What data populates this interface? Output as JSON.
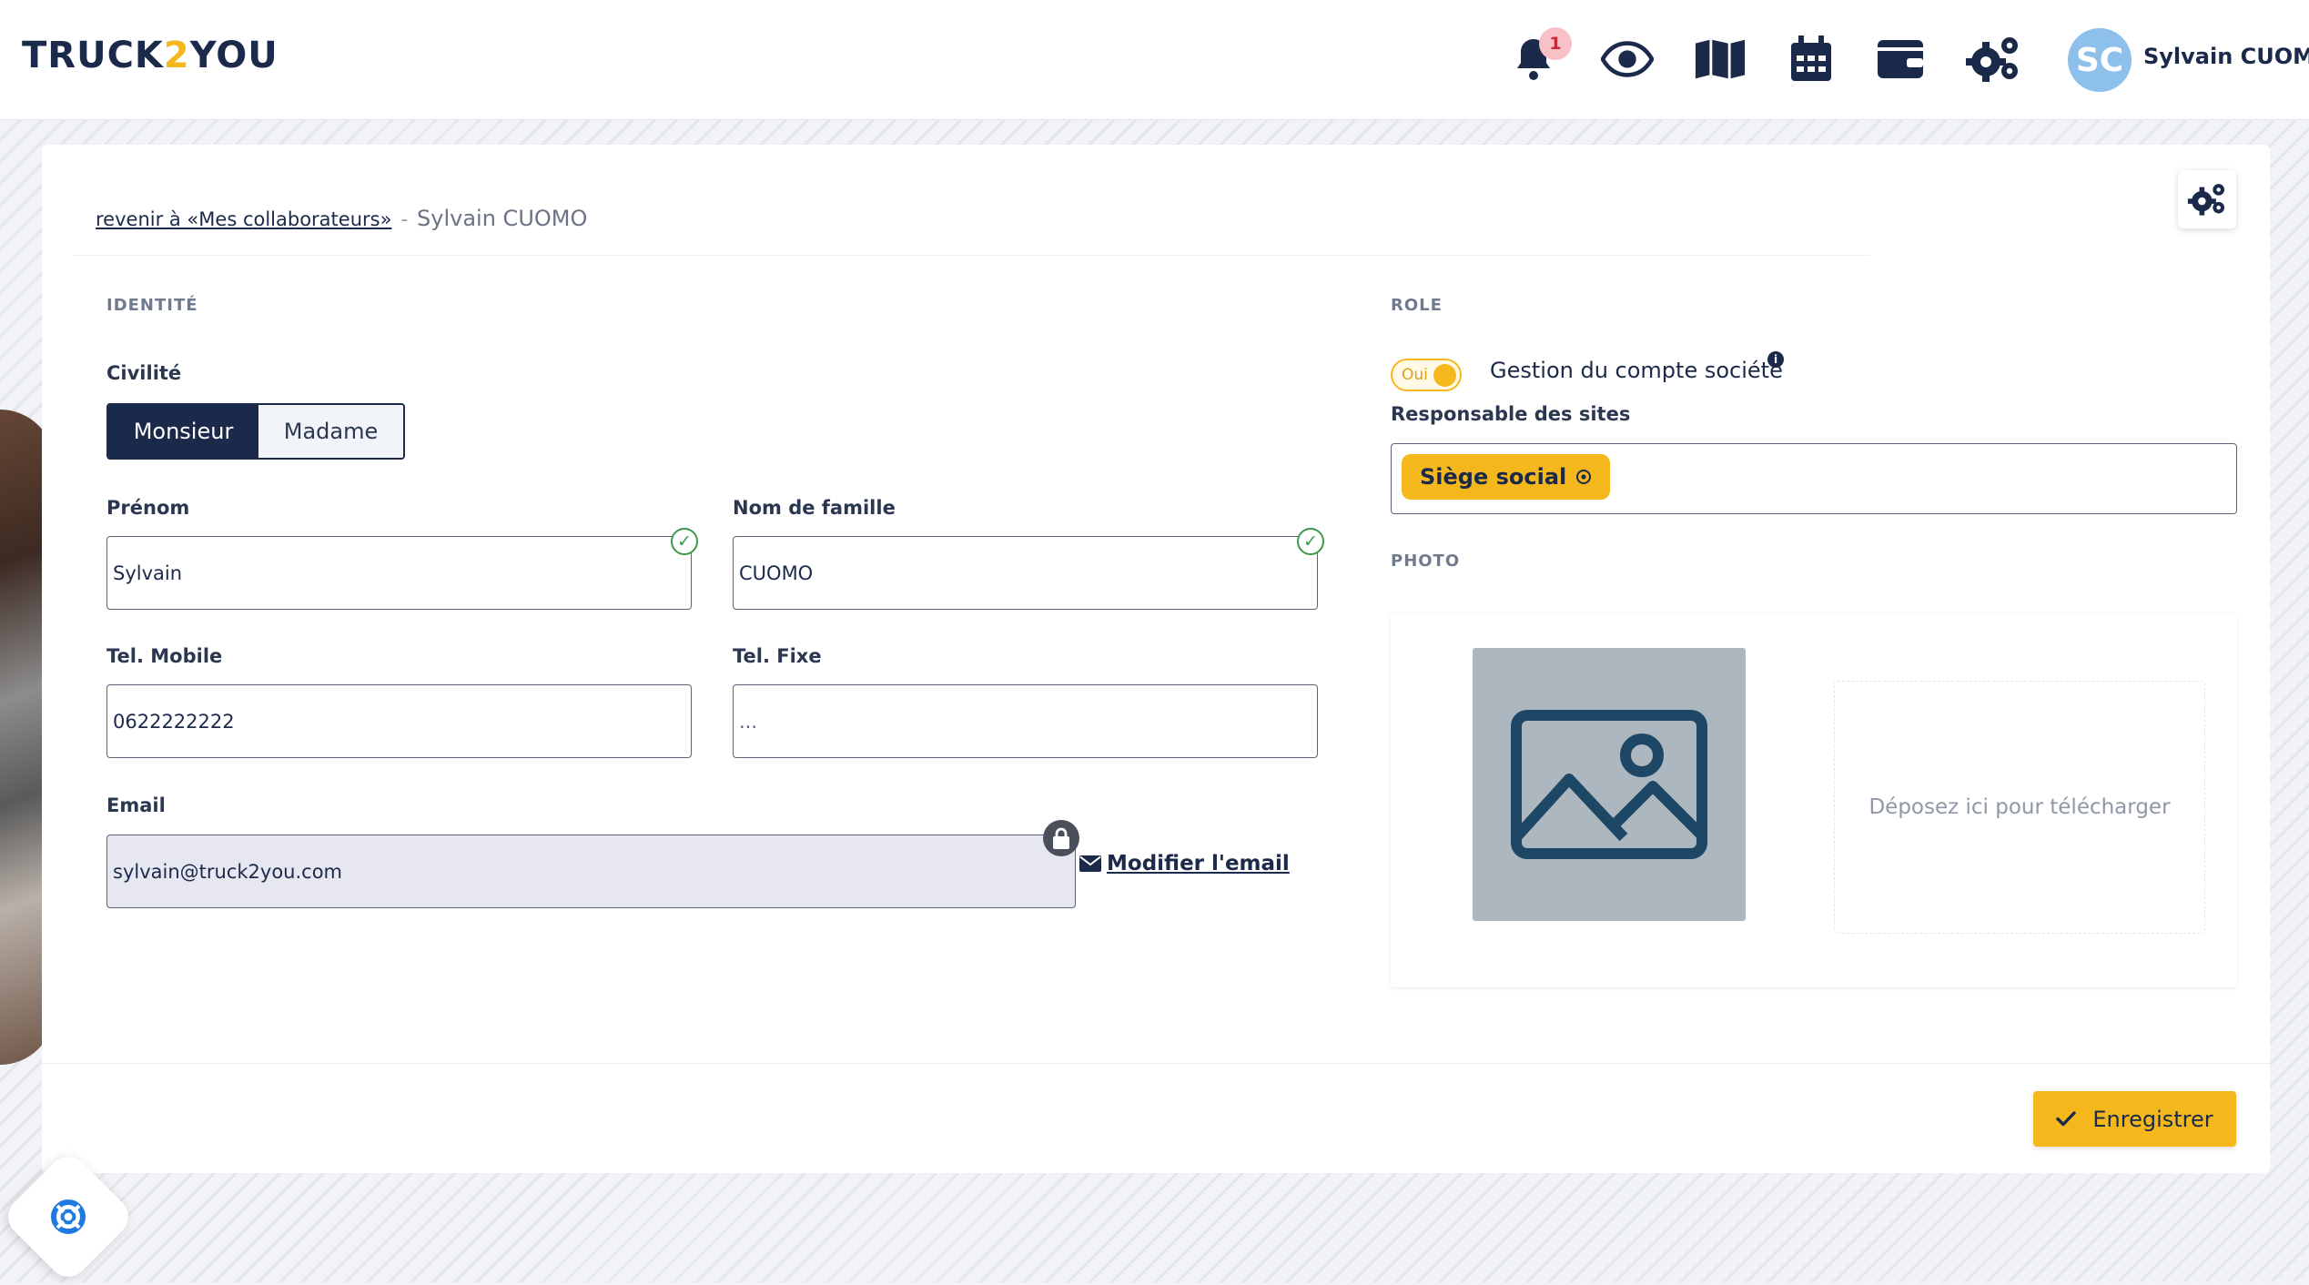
{
  "app": {
    "logo_left": "TRUCK",
    "logo_accent": "2",
    "logo_right": "YOU"
  },
  "header": {
    "notification_count": "1",
    "avatar_initials": "SC",
    "user_name": "Sylvain CUOMO",
    "icons": [
      "bell-icon",
      "eye-icon",
      "map-icon",
      "calendar-icon",
      "wallet-icon",
      "gears-icon"
    ]
  },
  "breadcrumb": {
    "back_link": "revenir à «Mes collaborateurs»",
    "separator": "-",
    "current": "Sylvain CUOMO"
  },
  "identity": {
    "section_title": "IDENTITÉ",
    "civility_label": "Civilité",
    "civility_options": [
      "Monsieur",
      "Madame"
    ],
    "civility_selected": "Monsieur",
    "first_name_label": "Prénom",
    "first_name_value": "Sylvain",
    "last_name_label": "Nom de famille",
    "last_name_value": "CUOMO",
    "mobile_label": "Tel. Mobile",
    "mobile_value": "0622222222",
    "landline_label": "Tel. Fixe",
    "landline_value": "...",
    "email_label": "Email",
    "email_value": "sylvain@truck2you.com",
    "modify_email_label": "Modifier l'email"
  },
  "role": {
    "section_title": "ROLE",
    "toggle_label": "Oui",
    "toggle_on": true,
    "account_management_label": "Gestion du compte société",
    "sites_label": "Responsable des sites",
    "sites_tags": [
      "Siège social"
    ]
  },
  "photo": {
    "section_title": "PHOTO",
    "dropzone_text": "Déposez ici pour télécharger"
  },
  "actions": {
    "save_label": "Enregistrer"
  },
  "colors": {
    "navy": "#1b2a4a",
    "accent": "#f5b81c",
    "success": "#3b9a4e",
    "avatar": "#8ec0ec"
  }
}
